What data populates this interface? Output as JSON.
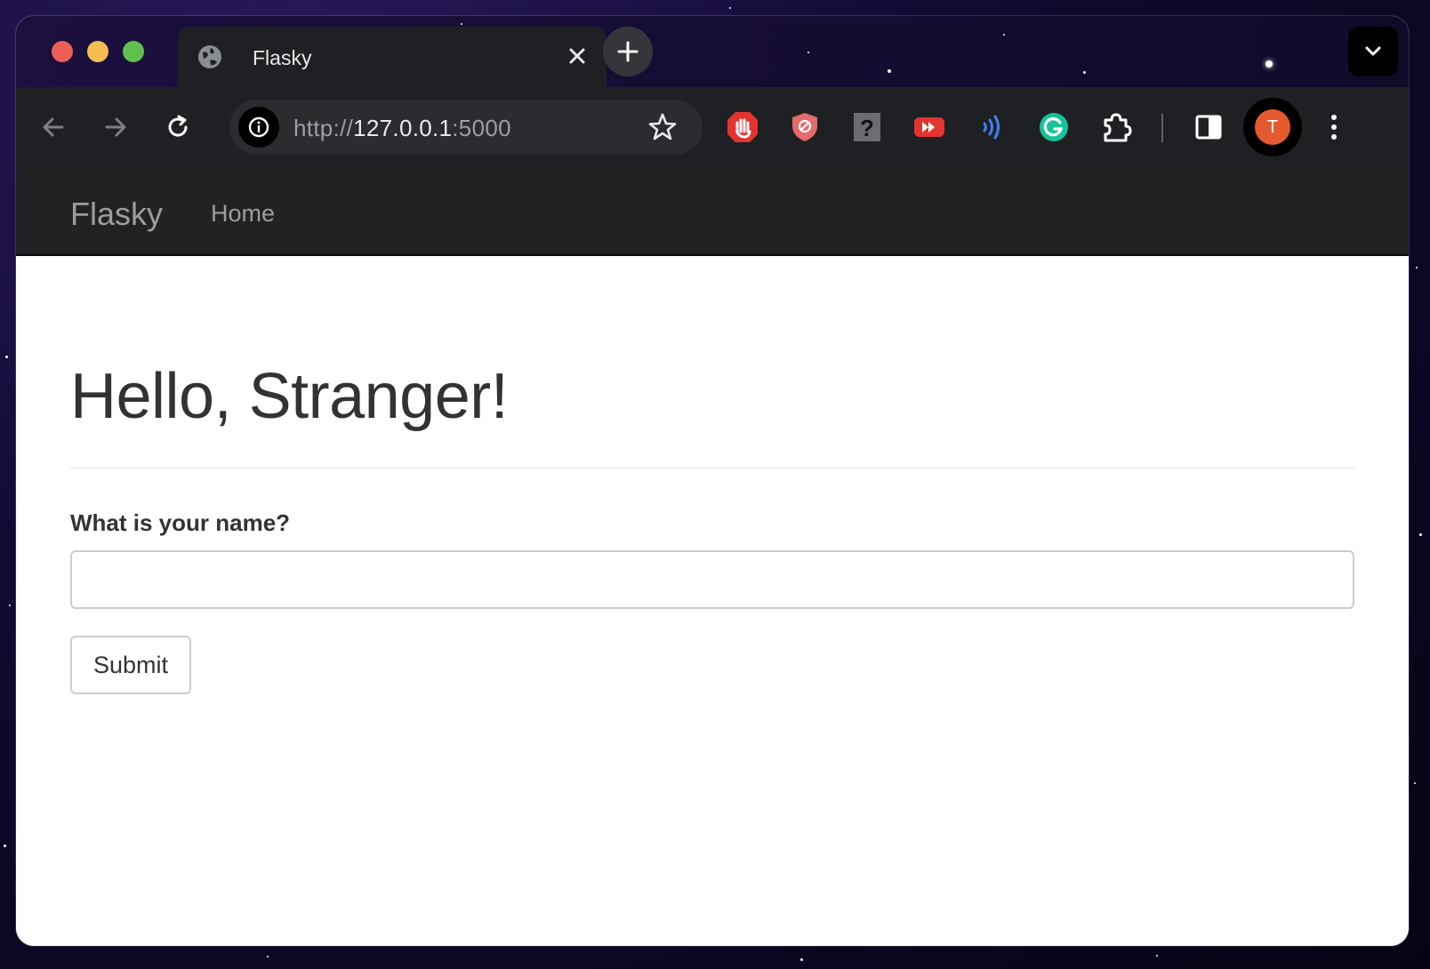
{
  "browser": {
    "tab_title": "Flasky",
    "url": {
      "scheme": "http://",
      "host": "127.0.0.1",
      "port": ":5000"
    },
    "profile_initial": "T",
    "colors": {
      "profile": "#e45a2e",
      "tab_bg": "#1f2023"
    },
    "icons": [
      "globe-icon",
      "close-icon",
      "plus-icon",
      "back-icon",
      "forward-icon",
      "reload-icon",
      "info-icon",
      "star-icon",
      "chevron-down-icon",
      "kebab-menu-icon"
    ],
    "extensions": [
      "adblock-hand-icon",
      "shield-block-icon",
      "question-icon",
      "fast-forward-icon",
      "signal-waves-icon",
      "grammarly-icon",
      "puzzle-icon",
      "side-panel-icon"
    ]
  },
  "page": {
    "brand": "Flasky",
    "nav": [
      "Home"
    ],
    "heading": "Hello, Stranger!",
    "form": {
      "label": "What is your name?",
      "input_value": "",
      "submit_label": "Submit"
    }
  }
}
